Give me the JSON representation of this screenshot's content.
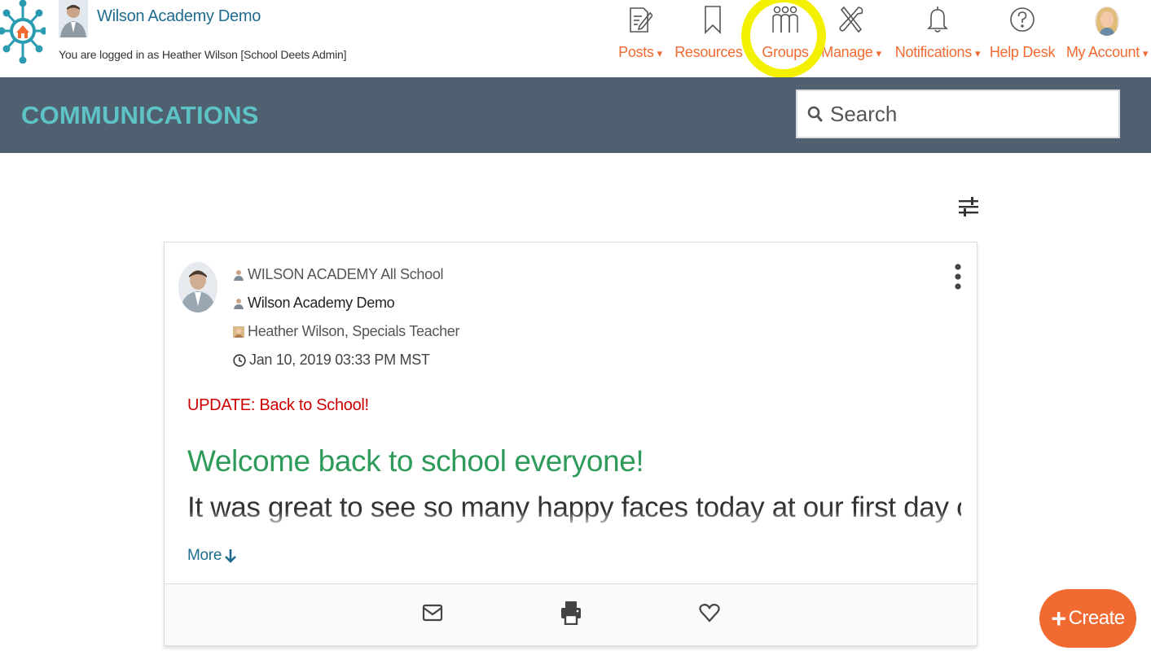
{
  "header": {
    "school_name": "Wilson Academy Demo",
    "logged_in_text": "You are logged in as Heather Wilson [School Deets Admin]"
  },
  "nav": {
    "posts": {
      "label": "Posts",
      "caret": "▾",
      "icon": "posts-edit-icon"
    },
    "resources": {
      "label": "Resources",
      "caret": "▾",
      "icon": "bookmark-icon"
    },
    "groups": {
      "label": "Groups",
      "icon": "groups-people-icon"
    },
    "manage": {
      "label": "Manage",
      "caret": "▾",
      "icon": "tools-icon"
    },
    "notifications": {
      "label": "Notifications",
      "caret": "▾",
      "icon": "bell-icon"
    },
    "help_desk": {
      "label": "Help Desk",
      "icon": "question-circle-icon"
    },
    "my_account": {
      "label": "My Account",
      "caret": "▾",
      "icon": "user-avatar"
    }
  },
  "banner": {
    "title": "COMMUNICATIONS",
    "search_placeholder": "Search"
  },
  "post": {
    "group": "WILSON ACADEMY All School",
    "school": "Wilson Academy Demo",
    "author": "Heather Wilson, Specials Teacher",
    "date": "Jan 10, 2019 03:33 PM MST",
    "subject": "UPDATE: Back to School!",
    "heading": "Welcome back to school everyone!",
    "body_preview": "It was great to see so many happy faces today at our first day of",
    "more_label": "More"
  },
  "create_button": {
    "label": "Create"
  },
  "colors": {
    "accent_orange": "#f06a32",
    "banner_bg": "#4f6070",
    "banner_title": "#5ec3c6",
    "link_blue": "#1f6c8f",
    "subject_red": "#cc0000",
    "heading_green": "#2e9b5a",
    "highlight_yellow": "#f4f100"
  }
}
